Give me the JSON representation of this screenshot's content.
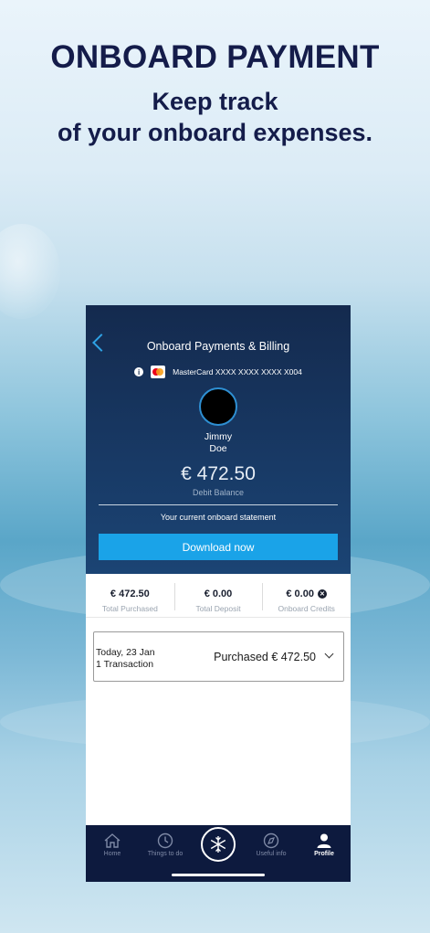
{
  "headline": {
    "title": "ONBOARD PAYMENT",
    "line1": "Keep track",
    "line2": "of your onboard expenses."
  },
  "screen": {
    "title": "Onboard Payments & Billing",
    "card_text": "MasterCard XXXX XXXX XXXX X004",
    "user_first": "Jimmy",
    "user_last": "Doe",
    "balance": "€ 472.50",
    "balance_label": "Debit Balance",
    "statement_label": "Your current onboard statement",
    "download_label": "Download now",
    "summary": [
      {
        "value": "€ 472.50",
        "label": "Total Purchased"
      },
      {
        "value": "€ 0.00",
        "label": "Total Deposit"
      },
      {
        "value": "€ 0.00",
        "label": "Onboard Credits"
      }
    ],
    "transaction": {
      "date": "Today, 23 Jan",
      "count": "1 Transaction",
      "summary": "Purchased € 472.50"
    },
    "nav": {
      "home": "Home",
      "things": "Things to do",
      "useful": "Useful info",
      "profile": "Profile"
    }
  },
  "colors": {
    "headline": "#141c4a",
    "header_bg": "#183a66",
    "accent": "#1aa3e8",
    "nav_bg": "#0d1a3e"
  }
}
